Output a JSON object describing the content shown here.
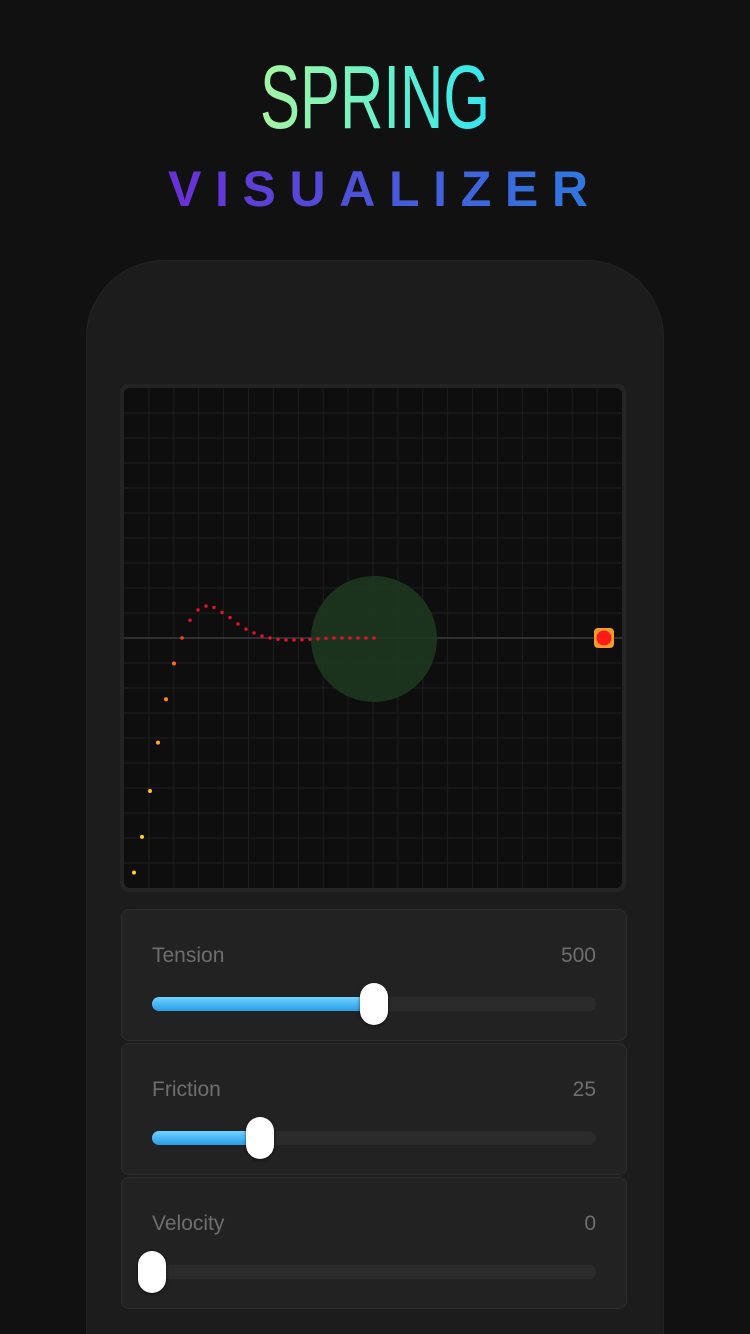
{
  "header": {
    "title_line1": "SPRING",
    "title_line2": "VISUALIZER"
  },
  "colors": {
    "spring_gradient": [
      "#a8f5a0",
      "#5ef0d8",
      "#33e5f0"
    ],
    "visualizer_gradient": [
      "#6a2fd6",
      "#4a56d8",
      "#2f78e0"
    ],
    "slider_fill": "#2a9be8",
    "target_dot": "#ff1a1a",
    "target_border": "#f39c2a",
    "equilibrium_circle": "#1d3a1f"
  },
  "visualizer": {
    "trail": [
      {
        "t": 0,
        "v": -0.92
      },
      {
        "t": 1,
        "v": -0.78
      },
      {
        "t": 2,
        "v": -0.6
      },
      {
        "t": 3,
        "v": -0.41
      },
      {
        "t": 4,
        "v": -0.24
      },
      {
        "t": 5,
        "v": -0.1
      },
      {
        "t": 6,
        "v": 0.0
      },
      {
        "t": 7,
        "v": 0.07
      },
      {
        "t": 8,
        "v": 0.11
      },
      {
        "t": 9,
        "v": 0.125
      },
      {
        "t": 10,
        "v": 0.12
      },
      {
        "t": 11,
        "v": 0.1
      },
      {
        "t": 12,
        "v": 0.08
      },
      {
        "t": 13,
        "v": 0.055
      },
      {
        "t": 14,
        "v": 0.035
      },
      {
        "t": 15,
        "v": 0.02
      },
      {
        "t": 16,
        "v": 0.008
      },
      {
        "t": 17,
        "v": 0.0
      },
      {
        "t": 18,
        "v": -0.005
      },
      {
        "t": 19,
        "v": -0.008
      },
      {
        "t": 20,
        "v": -0.008
      },
      {
        "t": 21,
        "v": -0.007
      },
      {
        "t": 22,
        "v": -0.005
      },
      {
        "t": 23,
        "v": -0.003
      },
      {
        "t": 24,
        "v": -0.001
      },
      {
        "t": 25,
        "v": 0.0
      },
      {
        "t": 26,
        "v": 0.0
      },
      {
        "t": 27,
        "v": 0.0
      },
      {
        "t": 28,
        "v": 0.0
      },
      {
        "t": 29,
        "v": 0.0
      },
      {
        "t": 30,
        "v": 0.0
      }
    ]
  },
  "controls": [
    {
      "label": "Tension",
      "value": "500",
      "fraction": 0.5
    },
    {
      "label": "Friction",
      "value": "25",
      "fraction": 0.243
    },
    {
      "label": "Velocity",
      "value": "0",
      "fraction": 0.0
    }
  ]
}
